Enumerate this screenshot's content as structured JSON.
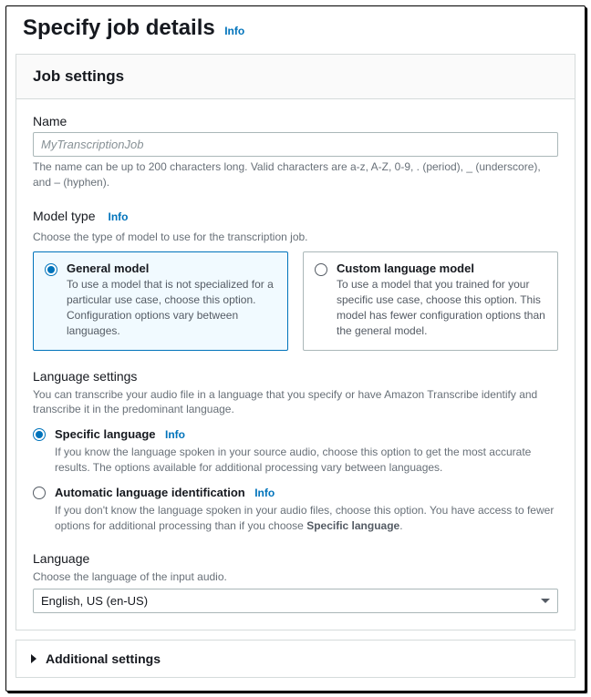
{
  "header": {
    "title": "Specify job details",
    "info": "Info"
  },
  "jobSettings": {
    "title": "Job settings",
    "name": {
      "label": "Name",
      "placeholder": "MyTranscriptionJob",
      "help": "The name can be up to 200 characters long. Valid characters are a-z, A-Z, 0-9, . (period), _ (underscore), and – (hyphen)."
    },
    "modelType": {
      "label": "Model type",
      "info": "Info",
      "help": "Choose the type of model to use for the transcription job.",
      "general": {
        "title": "General model",
        "desc": "To use a model that is not specialized for a particular use case, choose this option. Configuration options vary between languages."
      },
      "custom": {
        "title": "Custom language model",
        "desc": "To use a model that you trained for your specific use case, choose this option. This model has fewer configuration options than the general model."
      }
    },
    "languageSettings": {
      "label": "Language settings",
      "help": "You can transcribe your audio file in a language that you specify or have Amazon Transcribe identify and transcribe it in the predominant language.",
      "specific": {
        "title": "Specific language",
        "info": "Info",
        "desc": "If you know the language spoken in your source audio, choose this option to get the most accurate results. The options available for additional processing vary between languages."
      },
      "auto": {
        "title": "Automatic language identification",
        "info": "Info",
        "descPrefix": "If you don't know the language spoken in your audio files, choose this option. You have access to fewer options for additional processing than if you choose ",
        "descBold": "Specific language",
        "descSuffix": "."
      }
    },
    "language": {
      "label": "Language",
      "help": "Choose the language of the input audio.",
      "value": "English, US (en-US)"
    }
  },
  "additional": {
    "title": "Additional settings"
  }
}
